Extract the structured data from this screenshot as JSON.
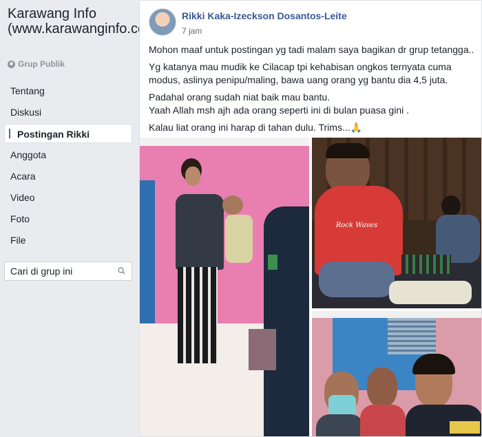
{
  "group": {
    "title": "Karawang Info (www.karawanginfo.com)",
    "type": "Grup Publik"
  },
  "nav": {
    "items": [
      {
        "label": "Tentang"
      },
      {
        "label": "Diskusi"
      },
      {
        "label": "Postingan Rikki"
      },
      {
        "label": "Anggota"
      },
      {
        "label": "Acara"
      },
      {
        "label": "Video"
      },
      {
        "label": "Foto"
      },
      {
        "label": "File"
      }
    ],
    "active_index": 2
  },
  "search": {
    "placeholder": "Cari di grup ini"
  },
  "post": {
    "author": "Rikki Kaka-Izeckson Dosantos-Leite",
    "time": "7 jam",
    "paragraphs": [
      "Mohon maaf untuk postingan yg tadi malam saya bagikan dr grup tetangga..",
      "Yg katanya mau mudik ke Cilacap tpi kehabisan ongkos ternyata cuma modus, aslinya penipu/maling, bawa uang orang yg bantu dia 4,5 juta.",
      "Padahal orang sudah niat baik mau bantu.",
      "Yaah Allah msh ajh ada orang seperti ini di bulan puasa gini .",
      "Kalau liat orang ini harap di tahan dulu. Trims..."
    ],
    "emoji": "🙏",
    "shirt_text": "Rock Waves"
  },
  "colors": {
    "background": "#e9ebee",
    "link": "#385898",
    "accent": "#4267b2"
  }
}
